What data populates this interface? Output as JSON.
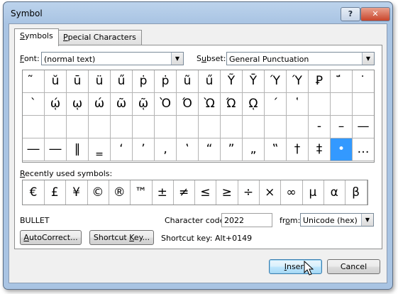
{
  "window": {
    "title": "Symbol",
    "help_label": "?",
    "close_label": "✕"
  },
  "tabs": [
    {
      "label_pre": "",
      "label_key": "S",
      "label_post": "ymbols"
    },
    {
      "label_pre": "",
      "label_key": "P",
      "label_post": "pecial Characters"
    }
  ],
  "font": {
    "label_key": "F",
    "label_post": "ont:",
    "value": "(normal text)"
  },
  "subset": {
    "label_key": "u",
    "label_pre": "S",
    "label_post": "bset:",
    "value": "General Punctuation"
  },
  "symbol_grid": [
    [
      "̃",
      "ŭ",
      "ū",
      "ü",
      "ű",
      "ṗ",
      "ṗ",
      "ũ",
      "ű",
      "Ỹ",
      "Ȳ",
      "Ύ",
      "Ύ",
      "Ꝑ",
      "̈́",
      "͘"
    ],
    [
      "`",
      "ῴ",
      "ῳ",
      "ώ",
      "ῶ",
      "ῷ",
      "Ὸ",
      "Ό",
      "Ὼ",
      "Ώ",
      "ῼ",
      "´",
      "῾",
      "",
      "",
      ""
    ],
    [
      "",
      "",
      "",
      "",
      "",
      "",
      "",
      "",
      "",
      "",
      "",
      "",
      "",
      "‐",
      "–",
      "—"
    ],
    [
      "―",
      "―",
      "‖",
      "‗",
      "‘",
      "’",
      "‚",
      "‛",
      "“",
      "”",
      "„",
      "‟",
      "†",
      "‡",
      "•",
      "…"
    ]
  ],
  "selected_symbol": "•",
  "recent": {
    "label_key": "R",
    "label_post": "ecently used symbols:",
    "symbols": [
      "€",
      "£",
      "¥",
      "©",
      "®",
      "™",
      "±",
      "≠",
      "≤",
      "≥",
      "÷",
      "×",
      "∞",
      "µ",
      "α",
      "β"
    ]
  },
  "character_name": "BULLET",
  "character_code": {
    "label": "Character code:",
    "value": "2022"
  },
  "from": {
    "label_pre": "fr",
    "label_key": "o",
    "label_post": "m:",
    "value": "Unicode (hex)"
  },
  "buttons": {
    "autocorrect_key": "A",
    "autocorrect_post": "utoCorrect...",
    "shortcut_pre": "Shortcut ",
    "shortcut_key": "K",
    "shortcut_post": "ey...",
    "insert_key": "I",
    "insert_post": "nsert",
    "cancel": "Cancel"
  },
  "shortcut_text": "Shortcut key: Alt+0149",
  "icons": {
    "dropdown": "chevron-down-icon",
    "scroll_up": "scroll-up-icon",
    "scroll_down": "scroll-down-icon",
    "cursor": "mouse-pointer-icon"
  }
}
